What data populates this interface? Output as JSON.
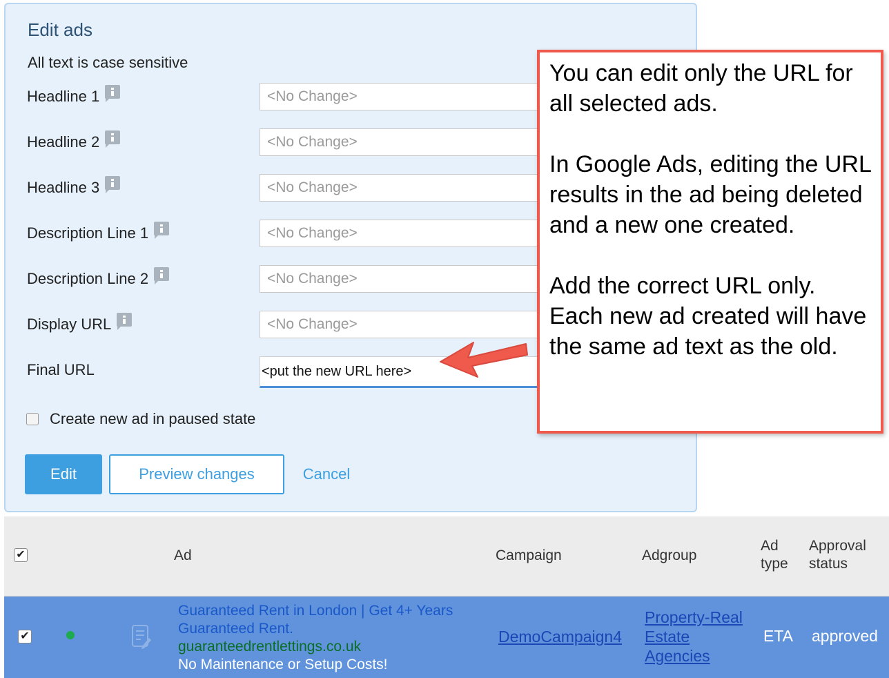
{
  "panel": {
    "title": "Edit ads",
    "case_note": "All text is case sensitive",
    "fields": [
      {
        "label": "Headline 1",
        "placeholder": "<No Change>"
      },
      {
        "label": "Headline 2",
        "placeholder": "<No Change>"
      },
      {
        "label": "Headline 3",
        "placeholder": "<No Change>"
      },
      {
        "label": "Description Line 1",
        "placeholder": "<No Change>"
      },
      {
        "label": "Description Line 2",
        "placeholder": "<No Change>"
      },
      {
        "label": "Display URL",
        "placeholder": "<No Change>"
      }
    ],
    "final_url": {
      "label": "Final URL",
      "value": "<put the new URL here>"
    },
    "paused_checkbox": {
      "label": "Create new ad in paused state",
      "checked": false
    },
    "buttons": {
      "edit": "Edit",
      "preview": "Preview changes",
      "cancel": "Cancel"
    }
  },
  "callout": {
    "paragraph1": "You can edit only the URL for all selected ads.",
    "paragraph2": "In Google Ads, editing the URL results in the ad being deleted and a new one created.",
    "paragraph3": "Add the correct URL only. Each new ad created will have the same ad text as the old."
  },
  "table": {
    "headers": {
      "ad": "Ad",
      "campaign": "Campaign",
      "adgroup": "Adgroup",
      "ad_type_line1": "Ad",
      "ad_type_line2": "type",
      "approval_line1": "Approval",
      "approval_line2": "status"
    },
    "row": {
      "headline1": "Guaranteed Rent in London | Get 4+ Years",
      "headline2": "Guaranteed Rent.",
      "display_url": "guaranteedrentlettings.co.uk",
      "description": "No Maintenance or Setup Costs!",
      "campaign": "DemoCampaign4",
      "adgroup_line1": "Property-Real",
      "adgroup_line2": "Estate",
      "adgroup_line3": "Agencies",
      "ad_type": "ETA",
      "approval_status": "approved",
      "status_color": "#1faa4f"
    }
  },
  "colors": {
    "accent": "#3d9ee0",
    "callout_border": "#ef5a4d",
    "selected_row": "#6093dc"
  }
}
